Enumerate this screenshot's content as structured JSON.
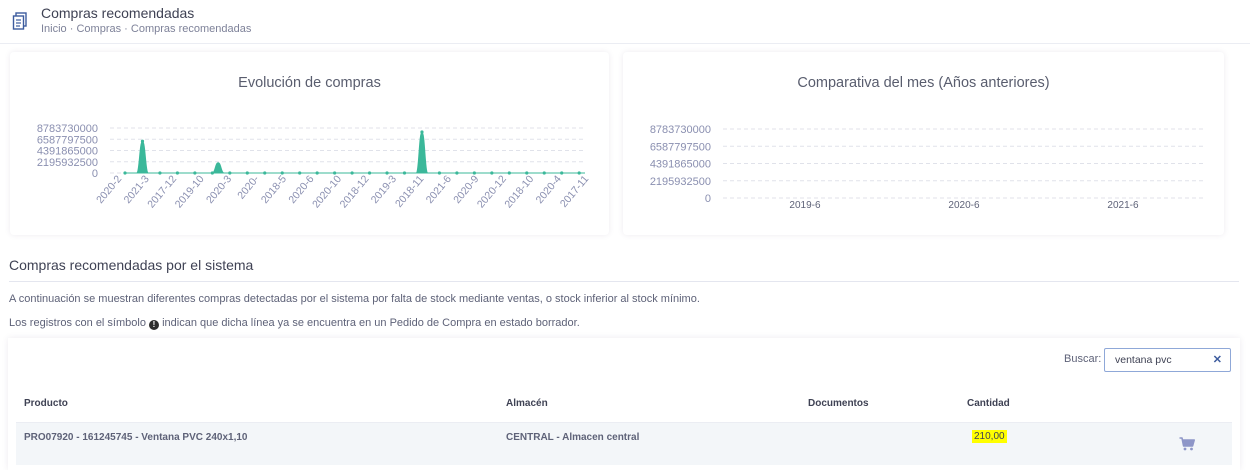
{
  "header": {
    "icon": "document-icon",
    "title": "Compras recomendadas",
    "breadcrumb": [
      "Inicio",
      "Compras",
      "Compras recomendadas"
    ],
    "separator": "·"
  },
  "charts": {
    "left_title": "Evolución de compras",
    "right_title": "Comparativa del mes (Años anteriores)"
  },
  "chart_data": [
    {
      "type": "area",
      "title": "Evolución de compras",
      "ytick_labels": [
        "8783730000",
        "6587797500",
        "4391865000",
        "2195932500",
        "0"
      ],
      "ylim": [
        0,
        8783730000
      ],
      "x_tick_labels": [
        "2020-2",
        "2021-3",
        "2017-12",
        "2019-10",
        "2020-3",
        "2020-",
        "2018-5",
        "2020-6",
        "2020-10",
        "2018-12",
        "2019-3",
        "2018-11",
        "2021-6",
        "2020-9",
        "2020-12",
        "2018-10",
        "2020-4",
        "2017-11"
      ],
      "values": [
        0,
        0,
        0,
        6200000000,
        0,
        0,
        0,
        0,
        0,
        0,
        0,
        0,
        0,
        0,
        0,
        0,
        2000000000,
        0,
        0,
        0,
        0,
        0,
        0,
        0,
        0,
        0,
        0,
        0,
        0,
        0,
        0,
        0,
        0,
        0,
        0,
        0,
        0,
        0,
        0,
        0,
        0,
        0,
        0,
        0,
        0,
        0,
        0,
        0,
        0,
        0,
        0,
        8000000000,
        0,
        0,
        0,
        0,
        0,
        0,
        0,
        0,
        0,
        0,
        0,
        0,
        0,
        0,
        0,
        0,
        0,
        0,
        0,
        0,
        0,
        0,
        0,
        0,
        0,
        0,
        0,
        0
      ],
      "color": "#3bb89a",
      "grid": true
    },
    {
      "type": "line",
      "title": "Comparativa del mes (Años anteriores)",
      "ytick_labels": [
        "8783730000",
        "6587797500",
        "4391865000",
        "2195932500",
        "0"
      ],
      "ylim": [
        0,
        8783730000
      ],
      "categories": [
        "2019-6",
        "2020-6",
        "2021-6"
      ],
      "values": [
        0,
        0,
        0
      ],
      "grid": true
    }
  ],
  "section": {
    "title": "Compras recomendadas por el sistema",
    "desc1": "A continuación se muestran diferentes compras detectadas por el sistema por falta de stock mediante ventas, o stock inferior al stock mínimo.",
    "desc2_before": "Los registros con el símbolo",
    "desc2_icon": "info-icon",
    "desc2_after": "indican que dicha línea ya se encuentra en un Pedido de Compra en estado borrador."
  },
  "table": {
    "search_label": "Buscar:",
    "search_value": "ventana pvc",
    "clear_icon": "close-icon",
    "columns": [
      "Producto",
      "Almacén",
      "Documentos",
      "Cantidad"
    ],
    "rows": [
      {
        "producto": "PRO07920 - 161245745 - Ventana PVC 240x1,10",
        "almacen": "CENTRAL - Almacen central",
        "documentos": "",
        "cantidad": "210,00",
        "action_icon": "cart-icon"
      }
    ]
  },
  "colors": {
    "accent": "#3bb89a",
    "cart": "#8e96c8",
    "highlight": "#ffff00"
  }
}
